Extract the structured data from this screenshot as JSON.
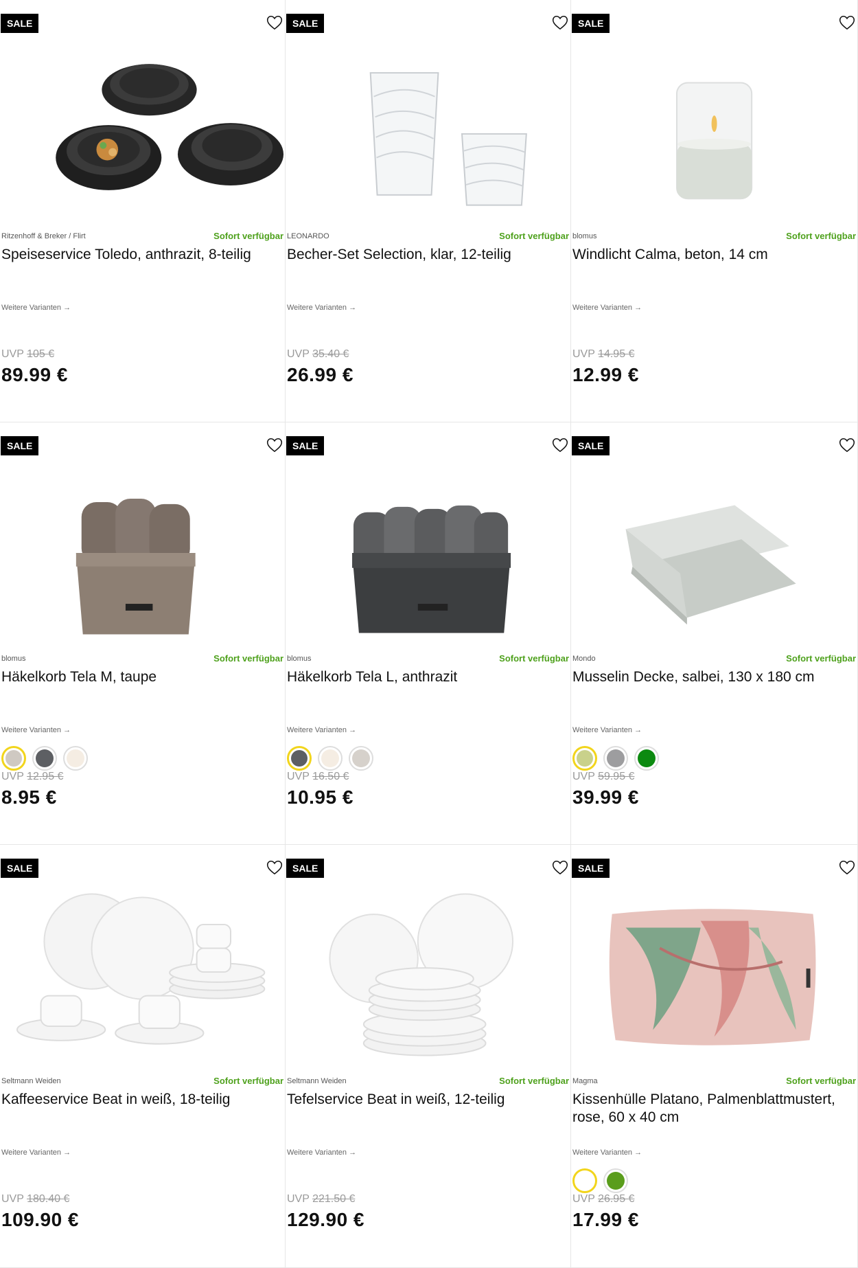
{
  "colors": {
    "available": "#4ea11c",
    "badge": "#000000",
    "selected_swatch_ring": "#f2d51c"
  },
  "labels": {
    "sale": "SALE",
    "available": "Sofort verfügbar",
    "variants": "Weitere Varianten →",
    "uvp": "UVP"
  },
  "products": [
    {
      "brand": "Ritzenhoff & Breker / Flirt",
      "name": "Speiseservice Toledo, anthrazit, 8-teilig",
      "uvp": "105 €",
      "price": "89.99 €",
      "icon": "dark-plates-image",
      "swatches": []
    },
    {
      "brand": "LEONARDO",
      "name": "Becher-Set Selection, klar, 12-teilig",
      "uvp": "35.40 €",
      "price": "26.99 €",
      "icon": "glasses-image",
      "swatches": []
    },
    {
      "brand": "blomus",
      "name": "Windlicht Calma, beton, 14 cm",
      "uvp": "14.95 €",
      "price": "12.99 €",
      "icon": "candle-holder-image",
      "swatches": []
    },
    {
      "brand": "blomus",
      "name": "Häkelkorb Tela M, taupe",
      "uvp": "12.95 €",
      "price": "8.95 €",
      "icon": "taupe-basket-image",
      "swatches": [
        "#cfc9c2",
        "#5d5f63",
        "#f5ede3"
      ]
    },
    {
      "brand": "blomus",
      "name": "Häkelkorb Tela L, anthrazit",
      "uvp": "16.50 €",
      "price": "10.95 €",
      "icon": "anthracite-basket-image",
      "swatches": [
        "#5d5f63",
        "#f5ede3",
        "#d6d1cb"
      ]
    },
    {
      "brand": "Mondo",
      "name": "Musselin Decke, salbei, 130 x 180 cm",
      "uvp": "59.95 €",
      "price": "39.99 €",
      "icon": "blanket-image",
      "swatches": [
        "#c9d18b",
        "#9d9d9f",
        "#0c8a10"
      ]
    },
    {
      "brand": "Seltmann Weiden",
      "name": "Kaffeeservice Beat in weiß, 18-teilig",
      "uvp": "180.40 €",
      "price": "109.90 €",
      "icon": "coffee-set-image",
      "swatches": []
    },
    {
      "brand": "Seltmann Weiden",
      "name": "Tefelservice Beat in weiß, 12-teilig",
      "uvp": "221.50 €",
      "price": "129.90 €",
      "icon": "dinner-set-image",
      "swatches": []
    },
    {
      "brand": "Magma",
      "name": "Kissenhülle Platano, Palmenblattmustert, rose, 60 x 40 cm",
      "uvp": "26.95 €",
      "price": "17.99 €",
      "icon": "cushion-image",
      "swatches": [
        "#ffffff",
        "#5a9d1c"
      ]
    }
  ]
}
